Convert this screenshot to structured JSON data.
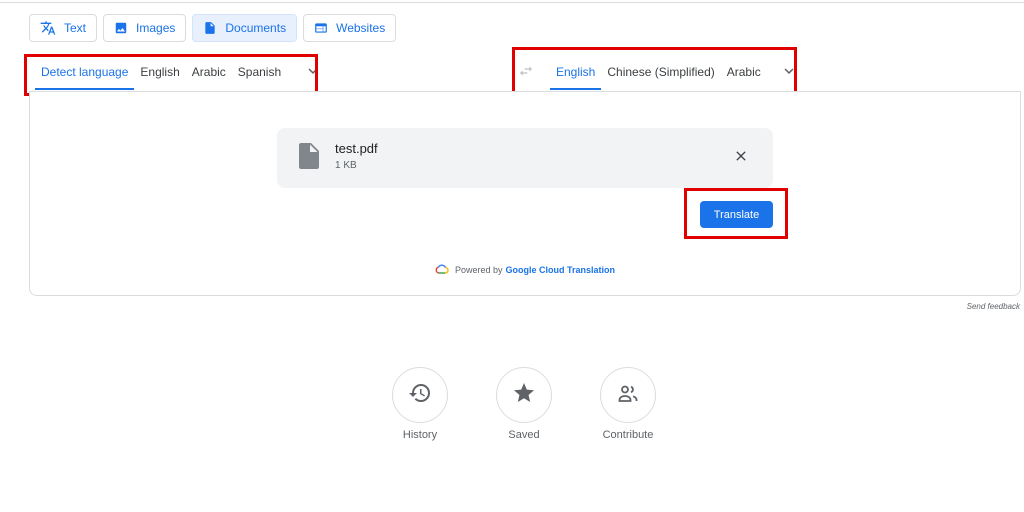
{
  "mode_tabs": [
    {
      "label": "Text",
      "icon": "translate-icon"
    },
    {
      "label": "Images",
      "icon": "image-icon"
    },
    {
      "label": "Documents",
      "icon": "document-icon",
      "active": true
    },
    {
      "label": "Websites",
      "icon": "website-icon"
    }
  ],
  "source_languages": {
    "items": [
      "Detect language",
      "English",
      "Arabic",
      "Spanish"
    ],
    "selected": "Detect language",
    "more_icon": "chevron-down-icon"
  },
  "target_languages": {
    "items": [
      "English",
      "Chinese (Simplified)",
      "Arabic"
    ],
    "selected": "English",
    "swap_icon": "swap-icon",
    "more_icon": "chevron-down-icon"
  },
  "file": {
    "name": "test.pdf",
    "size": "1 KB",
    "icon": "file-icon",
    "remove_icon": "close-icon"
  },
  "translate_label": "Translate",
  "powered_by": {
    "prefix": "Powered by",
    "link": "Google Cloud Translation",
    "icon": "google-cloud-icon"
  },
  "feedback_label": "Send feedback",
  "bottom_actions": [
    {
      "label": "History",
      "icon": "history-icon"
    },
    {
      "label": "Saved",
      "icon": "star-icon"
    },
    {
      "label": "Contribute",
      "icon": "people-icon"
    }
  ],
  "colors": {
    "accent": "#1a73e8",
    "highlight_box": "#e00000",
    "active_tab_bg": "#e8f0fe"
  }
}
